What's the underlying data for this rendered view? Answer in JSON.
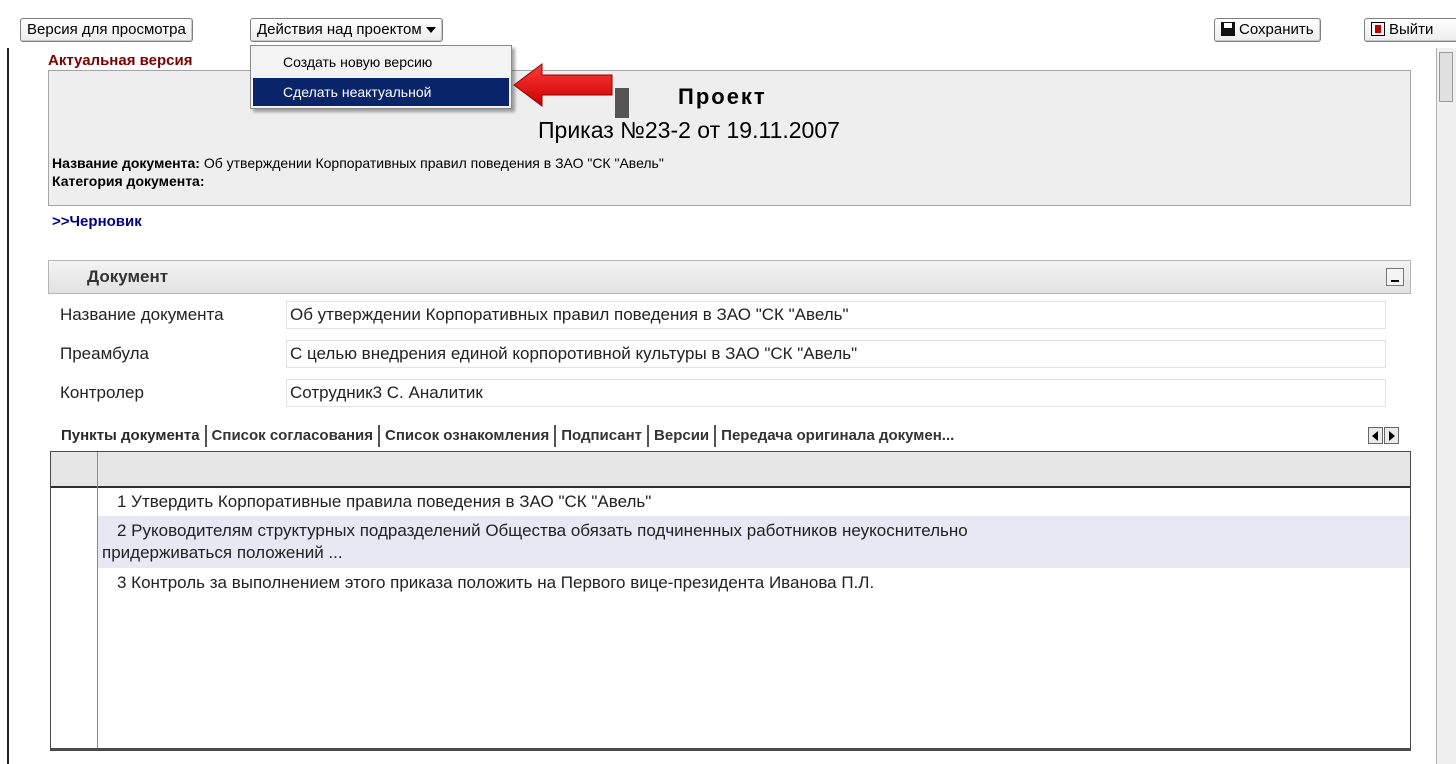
{
  "toolbar": {
    "view_version_label": "Версия для просмотра",
    "project_actions_label": "Действия над проектом",
    "save_label": "Сохранить",
    "exit_label": "Выйти"
  },
  "actual_version_label": "Актуальная версия",
  "project_menu": {
    "items": [
      {
        "label": "Создать новую версию",
        "selected": false
      },
      {
        "label": "Сделать неактуальной",
        "selected": true
      }
    ]
  },
  "header": {
    "title": "Проект",
    "order": "Приказ №23-2 от 19.11.2007",
    "doc_name_label": "Название документа:",
    "doc_name_value": "Об утверждении Корпоративных правил поведения в ЗАО \"СК \"Авель\"",
    "doc_category_label": "Категория документа:",
    "doc_category_value": ""
  },
  "draft_link": ">>Черновик",
  "document_section": {
    "title": "Документ",
    "fields": [
      {
        "label": "Название документа",
        "value": "Об утверждении Корпоративных правил поведения в ЗАО \"СК \"Авель\""
      },
      {
        "label": "Преамбула",
        "value": "С целью внедрения единой корпоротивной культуры в ЗАО \"СК \"Авель\""
      },
      {
        "label": "Контролер",
        "value": "Сотрудник3 С. Аналитик"
      }
    ]
  },
  "tabs": [
    "Пункты документа",
    "Список согласования",
    "Список ознакомления",
    "Подписант",
    "Версии",
    "Передача оригинала докумен..."
  ],
  "grid_rows": [
    {
      "line1": "1 Утвердить Корпоративные правила поведения в ЗАО \"СК \"Авель\"",
      "line2": ""
    },
    {
      "line1": "2 Руководителям структурных подразделений Общества обязать подчиненных работников неукоснительно",
      "line2": "придерживаться положений ..."
    },
    {
      "line1": "3 Контроль за выполнением этого приказа положить на Первого вице-президента Иванова П.Л.",
      "line2": ""
    }
  ],
  "colors": {
    "actual_version": "#7b0000",
    "draft_link": "#000080",
    "menu_selected_bg": "#0a246a",
    "arrow": "#e00000",
    "alt_row": "#e8e8f4"
  },
  "icons": [
    "save-icon",
    "exit-icon",
    "dropdown-arrow-icon",
    "minimize-icon",
    "tab-scroll-left-icon",
    "tab-scroll-right-icon",
    "red-arrow-icon"
  ]
}
